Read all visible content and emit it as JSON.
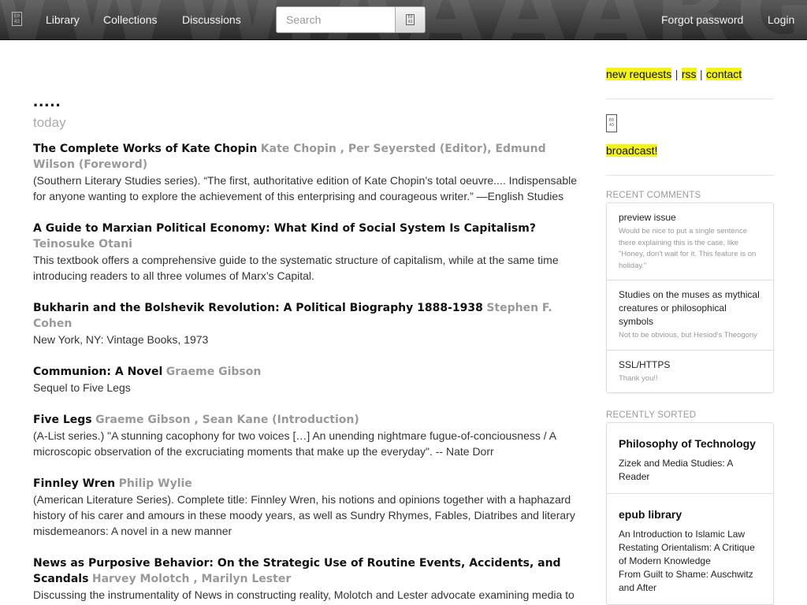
{
  "topbar": {
    "background_word": "WWW.AAAARG",
    "nav": [
      "Library",
      "Collections",
      "Discussions"
    ],
    "search_placeholder": "Search",
    "right_links": [
      "Forgot password",
      "Login"
    ]
  },
  "main": {
    "heading": ".....",
    "day_label": "today",
    "entries": [
      {
        "title": "The Complete Works of Kate Chopin",
        "authors": "Kate Chopin , Per Seyersted (Editor), Edmund Wilson (Foreword)",
        "description": "(Southern Literary Studies series). “The first, authoritative edition of Kate Chopin’s total oeuvre.... Indispensable for anyone wanting to explore the achievement of this enterprising and courageous writer.” —English Studies"
      },
      {
        "title": "A Guide to Marxian Political Economy: What Kind of Social System Is Capitalism?",
        "authors": "Teinosuke Otani",
        "description": "This textbook offers a comprehensive guide to the systematic structure of capitalism, while at the same time introducing readers to all three volumes of Marx’s Capital."
      },
      {
        "title": "Bukharin and the Bolshevik Revolution: A Political Biography 1888-1938",
        "authors": "Stephen F. Cohen",
        "description": "New York, NY: Vintage Books, 1973"
      },
      {
        "title": "Communion: A Novel",
        "authors": "Graeme Gibson",
        "description": "Sequel to Five Legs"
      },
      {
        "title": "Five Legs",
        "authors": "Graeme Gibson , Sean Kane (Introduction)",
        "description": "(A-List series.) \"A stunning cacophony for two voices […] An unending nightmare fugue-of-conciousness / A microscopic observation of the excruciating moments that make up the everyday\". -- Nate Dorr"
      },
      {
        "title": "Finnley Wren",
        "authors": "Philip Wylie",
        "description": "(American Literature Series). Complete title: Finnley Wren, his notions and opinions together with a haphazard history of his carer and amours in these moody years, as well as Sundry Rhymes, Fables, Diatribes and literary misdemeanors: A novel in a new manner"
      },
      {
        "title": "News as Purposive Behavior: On the Strategic Use of Routine Events, Accidents, and Scandals",
        "authors": "Harvey Molotch , Marilyn Lester",
        "description": "Discussing the instrumentality of News in constructing reality, Molotch and Lester advocate examining media to understand the powers behind it."
      }
    ]
  },
  "sidebar": {
    "links": [
      "new requests",
      "rss",
      "contact"
    ],
    "separator": "|",
    "broadcast": "broadcast!",
    "recent_comments_heading": "RECENT COMMENTS",
    "comments": [
      {
        "title": "preview issue",
        "body": "Would be nice to put a single sentence there explaining this is the case, like \"Honey, don't wait for it. This feature is on holiday.\""
      },
      {
        "title": "Studies on the muses as mythical creatures or philosophical symbols",
        "body": "Not to be obvious, but Hesiod's Theogony"
      },
      {
        "title": "SSL/HTTPS",
        "body": "Thank you!!"
      }
    ],
    "recently_sorted_heading": "RECENTLY SORTED",
    "collections": [
      {
        "title": "Philosophy of Technology",
        "items": [
          "Zizek and Media Studies: A Reader"
        ]
      },
      {
        "title": "epub library",
        "items": [
          "An Introduction to Islamic Law",
          "Restating Orientalism: A Critique of Modern Knowledge",
          "From Guilt to Shame: Auschwitz and After"
        ]
      }
    ]
  },
  "colors": {
    "highlight": "#f3f31a",
    "topbar": "#3a3a3a",
    "author_gray": "#999999"
  }
}
